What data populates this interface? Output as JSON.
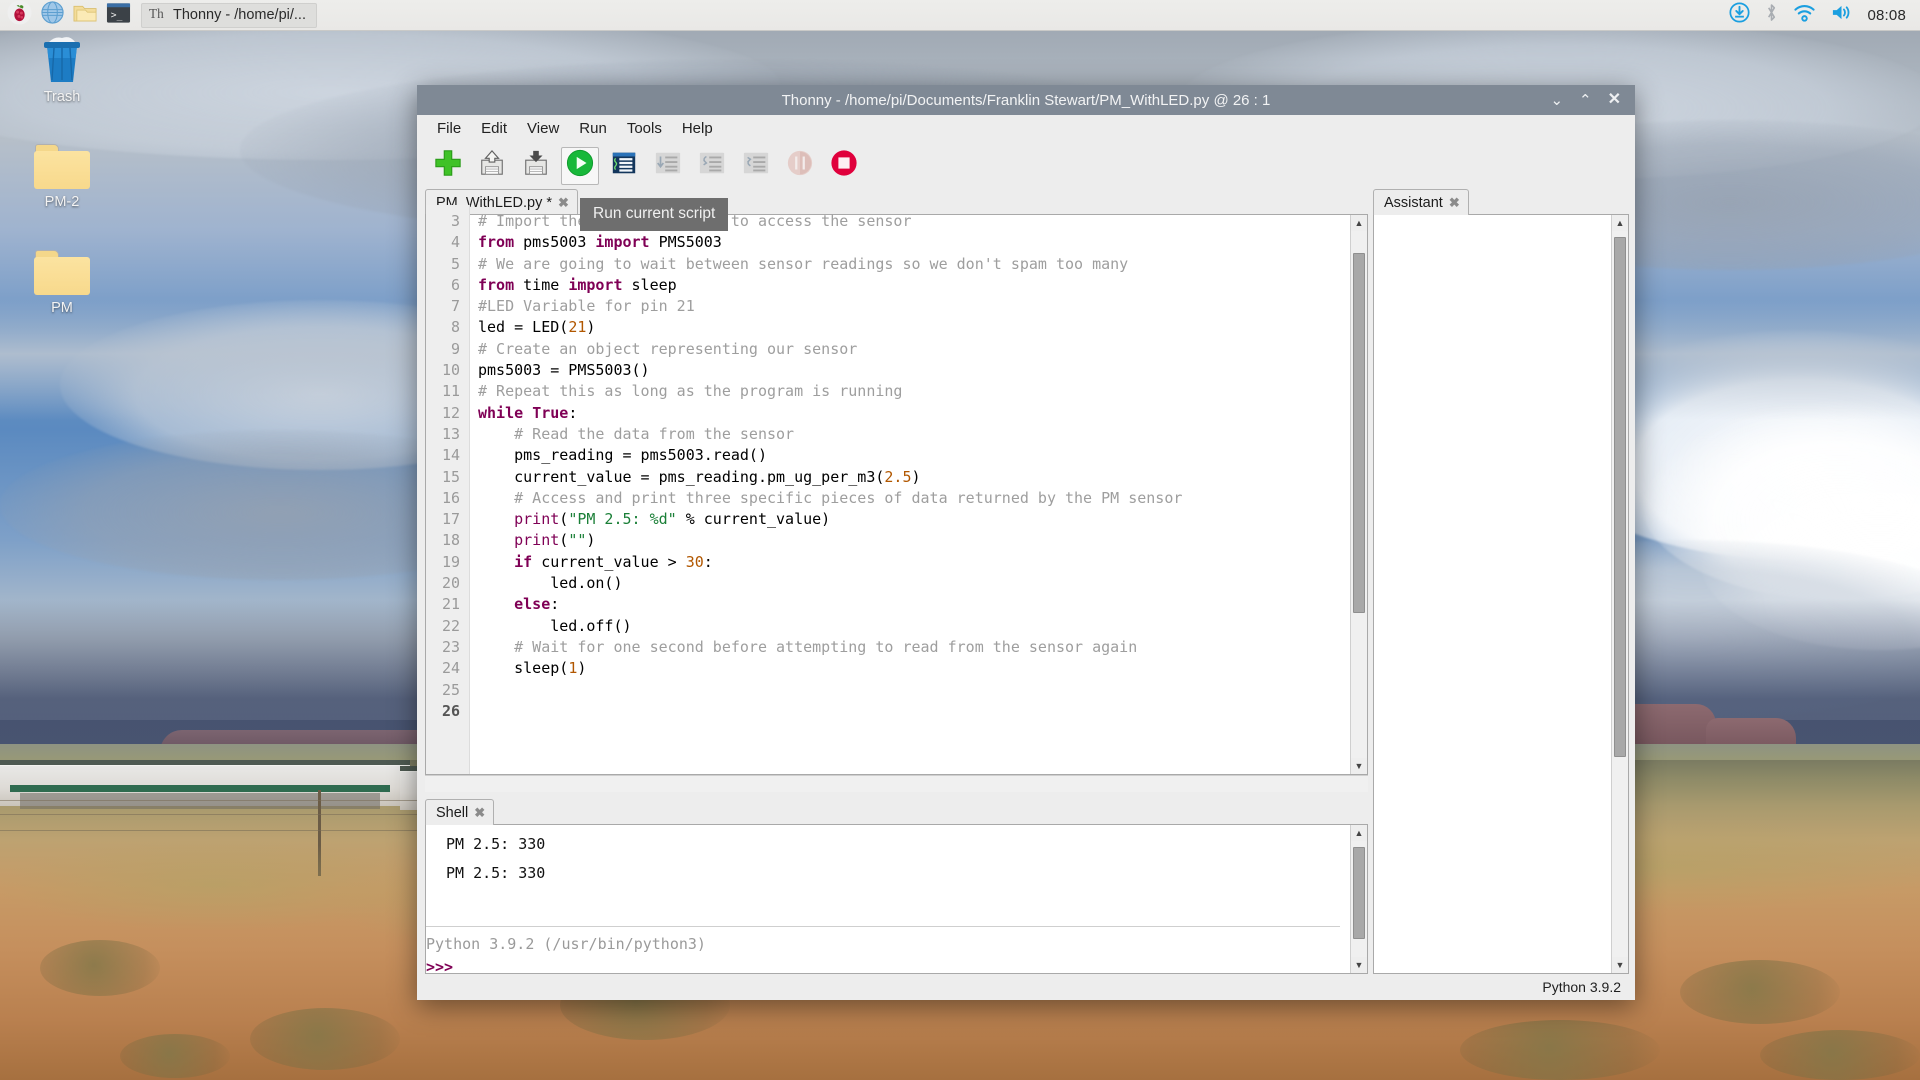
{
  "taskbar": {
    "launchers": [
      {
        "name": "raspberry-menu-icon",
        "label": "Menu"
      },
      {
        "name": "web-browser-icon",
        "label": "Web Browser"
      },
      {
        "name": "file-manager-icon",
        "label": "File Manager"
      },
      {
        "name": "terminal-icon",
        "label": "Terminal"
      }
    ],
    "window_button": {
      "icon": "thonny-icon",
      "label": "Thonny  -  /home/pi/..."
    },
    "tray": [
      {
        "name": "updates-icon",
        "label": "Updates available"
      },
      {
        "name": "bluetooth-icon",
        "label": "Bluetooth"
      },
      {
        "name": "wifi-icon",
        "label": "Wireless network"
      },
      {
        "name": "volume-icon",
        "label": "Volume"
      }
    ],
    "clock": "08:08"
  },
  "desktop": {
    "icons": [
      {
        "name": "trash",
        "label": "Trash",
        "type": "trash"
      },
      {
        "name": "pm-2-folder",
        "label": "PM-2",
        "type": "folder"
      },
      {
        "name": "pm-folder",
        "label": "PM",
        "type": "folder"
      }
    ]
  },
  "window": {
    "title": "Thonny  -  /home/pi/Documents/Franklin Stewart/PM_WithLED.py  @  26 : 1",
    "controls": {
      "minimize": "⌄",
      "maximize": "⌃",
      "close": "✕"
    },
    "menu": [
      "File",
      "Edit",
      "View",
      "Run",
      "Tools",
      "Help"
    ],
    "toolbar": [
      {
        "name": "new-file-button",
        "icon": "plus-icon",
        "state": "enabled"
      },
      {
        "name": "load-file-button",
        "icon": "floppy-up-icon",
        "state": "enabled"
      },
      {
        "name": "save-file-button",
        "icon": "floppy-down-icon",
        "state": "enabled"
      },
      {
        "name": "run-current-script-button",
        "icon": "play-icon",
        "state": "focused"
      },
      {
        "name": "debug-current-script-button",
        "icon": "debug-icon",
        "state": "enabled"
      },
      {
        "name": "step-over-button",
        "icon": "step-over-icon",
        "state": "disabled"
      },
      {
        "name": "step-into-button",
        "icon": "step-into-icon",
        "state": "disabled"
      },
      {
        "name": "step-out-button",
        "icon": "step-out-icon",
        "state": "disabled"
      },
      {
        "name": "resume-button",
        "icon": "resume-icon",
        "state": "disabled"
      },
      {
        "name": "stop-button",
        "icon": "stop-icon",
        "state": "enabled"
      }
    ],
    "tooltip": "Run current script",
    "editor": {
      "tab_label": "PM_WithLED.py *",
      "tab_close": "✖",
      "first_visible_line": 3,
      "current_line": 26,
      "lines": [
        {
          "n": 3,
          "tokens": [
            {
              "t": "# Import the library we use to access the sensor",
              "c": "cmt"
            }
          ]
        },
        {
          "n": 4,
          "tokens": [
            {
              "t": "from ",
              "c": "kw"
            },
            {
              "t": "pms5003 ",
              "c": ""
            },
            {
              "t": "import ",
              "c": "kw"
            },
            {
              "t": "PMS5003",
              "c": ""
            }
          ]
        },
        {
          "n": 5,
          "tokens": [
            {
              "t": "# We are going to wait between sensor readings so we don't spam too many",
              "c": "cmt"
            }
          ]
        },
        {
          "n": 6,
          "tokens": [
            {
              "t": "from ",
              "c": "kw"
            },
            {
              "t": "time ",
              "c": ""
            },
            {
              "t": "import ",
              "c": "kw"
            },
            {
              "t": "sleep",
              "c": ""
            }
          ]
        },
        {
          "n": 7,
          "tokens": [
            {
              "t": "#LED Variable for pin 21",
              "c": "cmt"
            }
          ]
        },
        {
          "n": 8,
          "tokens": [
            {
              "t": "led = LED(",
              "c": ""
            },
            {
              "t": "21",
              "c": "num"
            },
            {
              "t": ")",
              "c": ""
            }
          ]
        },
        {
          "n": 9,
          "tokens": [
            {
              "t": "# Create an object representing our sensor",
              "c": "cmt"
            }
          ]
        },
        {
          "n": 10,
          "tokens": [
            {
              "t": "pms5003 = PMS5003()",
              "c": ""
            }
          ]
        },
        {
          "n": 11,
          "tokens": [
            {
              "t": "# Repeat this as long as the program is running",
              "c": "cmt"
            }
          ]
        },
        {
          "n": 12,
          "tokens": [
            {
              "t": "while ",
              "c": "kw"
            },
            {
              "t": "True",
              "c": "kw"
            },
            {
              "t": ":",
              "c": ""
            }
          ]
        },
        {
          "n": 13,
          "tokens": [
            {
              "t": "    # Read the data from the sensor",
              "c": "cmt"
            }
          ]
        },
        {
          "n": 14,
          "tokens": [
            {
              "t": "    pms_reading = pms5003.read()",
              "c": ""
            }
          ]
        },
        {
          "n": 15,
          "tokens": [
            {
              "t": "    current_value = pms_reading.pm_ug_per_m3(",
              "c": ""
            },
            {
              "t": "2.5",
              "c": "num"
            },
            {
              "t": ")",
              "c": ""
            }
          ]
        },
        {
          "n": 16,
          "tokens": [
            {
              "t": "    # Access and print three specific pieces of data returned by the PM sensor",
              "c": "cmt"
            }
          ]
        },
        {
          "n": 17,
          "tokens": [
            {
              "t": "    ",
              "c": ""
            },
            {
              "t": "print",
              "c": "kw2"
            },
            {
              "t": "(",
              "c": ""
            },
            {
              "t": "\"PM 2.5: %d\"",
              "c": "str"
            },
            {
              "t": " % current_value)",
              "c": ""
            }
          ]
        },
        {
          "n": 18,
          "tokens": [
            {
              "t": "    ",
              "c": ""
            },
            {
              "t": "print",
              "c": "kw2"
            },
            {
              "t": "(",
              "c": ""
            },
            {
              "t": "\"\"",
              "c": "str"
            },
            {
              "t": ")",
              "c": ""
            }
          ]
        },
        {
          "n": 19,
          "tokens": [
            {
              "t": "    ",
              "c": ""
            },
            {
              "t": "if ",
              "c": "kw"
            },
            {
              "t": "current_value > ",
              "c": ""
            },
            {
              "t": "30",
              "c": "num"
            },
            {
              "t": ":",
              "c": ""
            }
          ]
        },
        {
          "n": 20,
          "tokens": [
            {
              "t": "        led.on()",
              "c": ""
            }
          ]
        },
        {
          "n": 21,
          "tokens": [
            {
              "t": "    ",
              "c": ""
            },
            {
              "t": "else",
              "c": "kw"
            },
            {
              "t": ":",
              "c": ""
            }
          ]
        },
        {
          "n": 22,
          "tokens": [
            {
              "t": "        led.off()",
              "c": ""
            }
          ]
        },
        {
          "n": 23,
          "tokens": [
            {
              "t": "    # Wait for one second before attempting to read from the sensor again",
              "c": "cmt"
            }
          ]
        },
        {
          "n": 24,
          "tokens": [
            {
              "t": "    sleep(",
              "c": ""
            },
            {
              "t": "1",
              "c": "num"
            },
            {
              "t": ")",
              "c": ""
            }
          ]
        },
        {
          "n": 25,
          "tokens": [
            {
              "t": "",
              "c": ""
            }
          ]
        },
        {
          "n": 26,
          "tokens": [
            {
              "t": "",
              "c": ""
            }
          ]
        }
      ]
    },
    "shell": {
      "tab_label": "Shell",
      "tab_close": "✖",
      "output": [
        "PM 2.5: 330",
        "PM 2.5: 330"
      ],
      "system_line": "Python 3.9.2 (/usr/bin/python3)",
      "prompt": ">>>"
    },
    "assistant": {
      "tab_label": "Assistant",
      "tab_close": "✖",
      "content": ""
    },
    "statusbar": {
      "interpreter": "Python 3.9.2"
    }
  },
  "colors": {
    "titlebar": "#7f8995",
    "chrome": "#ededed",
    "keyword": "#7f0055",
    "string": "#1a7f37",
    "comment": "#9e9e9e",
    "number": "#b15700",
    "accent_blue": "#1b9fe0",
    "run_green": "#18b83a",
    "stop_red": "#e0003c"
  }
}
